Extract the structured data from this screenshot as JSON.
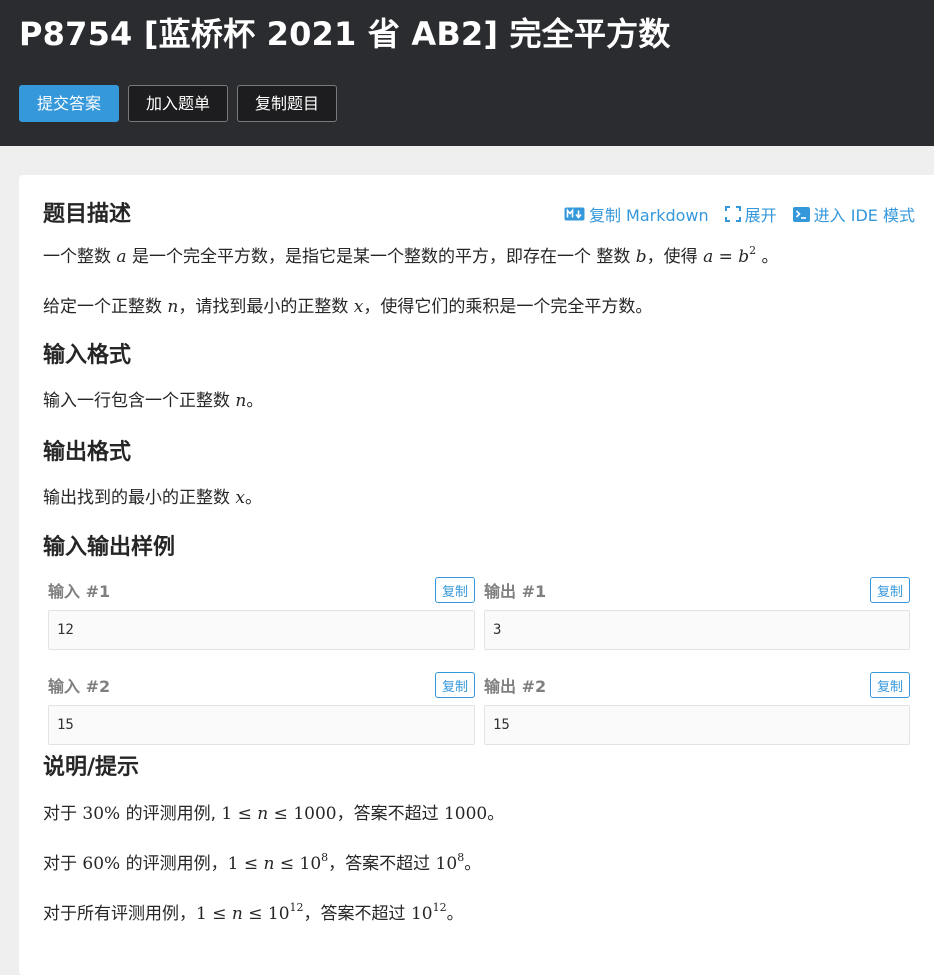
{
  "header": {
    "title": "P8754 [蓝桥杯 2021 省 AB2] 完全平方数",
    "buttons": {
      "submit": "提交答案",
      "add_list": "加入题单",
      "copy_problem": "复制题目"
    }
  },
  "tools": {
    "copy_markdown": "复制 Markdown",
    "expand": "展开",
    "ide_mode": "进入 IDE 模式"
  },
  "description": {
    "heading": "题目描述",
    "p1": {
      "t1": "一个整数 ",
      "a": "a",
      "t2": " 是一个完全平方数，是指它是某一个整数的平方，即存在一个 整数 ",
      "b": "b",
      "t3": "，使得 ",
      "eq_a": "a",
      "eq_op": " = ",
      "eq_b": "b",
      "eq_exp": "2",
      "t4": " 。"
    },
    "p2": {
      "t1": "给定一个正整数 ",
      "n": "n",
      "t2": "，请找到最小的正整数 ",
      "x": "x",
      "t3": "，使得它们的乘积是一个完全平方数。"
    }
  },
  "input_format": {
    "heading": "输入格式",
    "t1": "输入一行包含一个正整数 ",
    "n": "n",
    "t2": "。"
  },
  "output_format": {
    "heading": "输出格式",
    "t1": "输出找到的最小的正整数 ",
    "x": "x",
    "t2": "。"
  },
  "samples": {
    "heading": "输入输出样例",
    "copy_label": "复制",
    "items": [
      {
        "in_label": "输入 #1",
        "in_value": "12",
        "out_label": "输出 #1",
        "out_value": "3"
      },
      {
        "in_label": "输入 #2",
        "in_value": "15",
        "out_label": "输出 #2",
        "out_value": "15"
      }
    ]
  },
  "hint": {
    "heading": "说明/提示",
    "l1": {
      "t1": "对于 ",
      "pct": "30%",
      "t2": " 的评测用例, ",
      "lo": "1 ≤ ",
      "n": "n",
      "le": " ≤ ",
      "hi": "1000",
      "t3": "，答案不超过 ",
      "ans": "1000",
      "t4": "。"
    },
    "l2": {
      "t1": "对于 ",
      "pct": "60%",
      "t2": " 的评测用例，",
      "lo": "1 ≤ ",
      "n": "n",
      "le": " ≤ ",
      "hi": "10",
      "hi_exp": "8",
      "t3": "，答案不超过 ",
      "ans": "10",
      "ans_exp": "8",
      "t4": "。"
    },
    "l3": {
      "t1": "对于所有评测用例，",
      "lo": "1 ≤ ",
      "n": "n",
      "le": " ≤ ",
      "hi": "10",
      "hi_exp": "12",
      "t3": "，答案不超过 ",
      "ans": "10",
      "ans_exp": "12",
      "t4": "。"
    }
  }
}
